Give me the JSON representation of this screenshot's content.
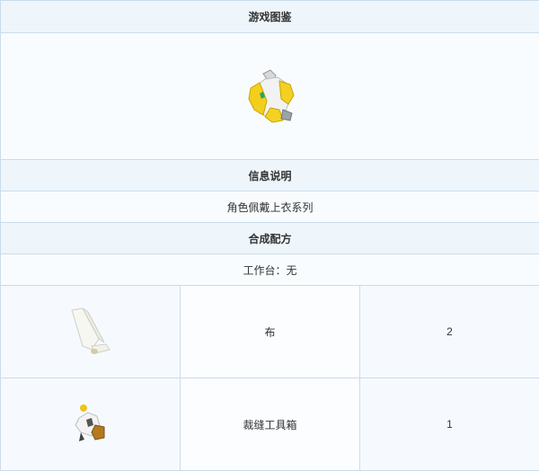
{
  "sections": {
    "illustration_title": "游戏图鉴",
    "info_title": "信息说明",
    "info_text": "角色佩戴上衣系列",
    "recipe_title": "合成配方",
    "workbench_text": "工作台：无"
  },
  "item_icon": "yellow-armor-vest-icon",
  "materials": [
    {
      "icon": "white-cloth-icon",
      "name": "布",
      "quantity": "2"
    },
    {
      "icon": "tailoring-toolbox-icon",
      "name": "裁缝工具箱",
      "quantity": "1"
    }
  ]
}
